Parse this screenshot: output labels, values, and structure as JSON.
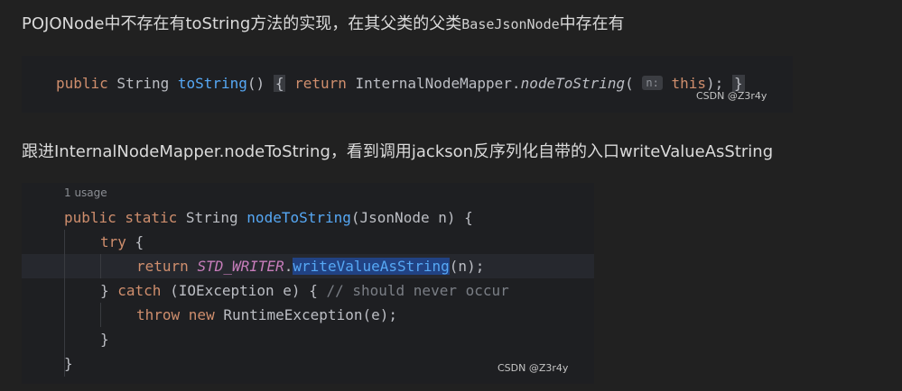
{
  "para1": {
    "before": "POJONode中不存在有toString方法的实现，在其父类的父类",
    "code": "BaseJsonNode",
    "after": "中存在有"
  },
  "snippet1": {
    "t1": "public",
    "t2": " String ",
    "t3": "toString",
    "t4": "() ",
    "t5": "{",
    "t6": " ",
    "t7": "return",
    "t8": " InternalNodeMapper.",
    "t9": "nodeToString",
    "t10": "( ",
    "hint": "n:",
    "t11": " ",
    "t12": "this",
    "t13": "); ",
    "t14": "}",
    "watermark": "CSDN @Z3r4y"
  },
  "para2": {
    "text": "跟进InternalNodeMapper.nodeToString，看到调用jackson反序列化自带的入口writeValueAsString"
  },
  "snippet2": {
    "usage": "1 usage",
    "l1": {
      "a": "public static",
      "b": " String ",
      "c": "nodeToString",
      "d": "(JsonNode n) {"
    },
    "l2": {
      "a": "try",
      "b": " {"
    },
    "l3": {
      "a": "return",
      "b": " ",
      "c": "STD_WRITER",
      "d": ".",
      "e": "writeValueAsString",
      "f": "(n);"
    },
    "l4": {
      "a": "} ",
      "b": "catch",
      "c": " (IOException e) { ",
      "d": "// should never occur"
    },
    "l5": {
      "a": "throw new",
      "b": " RuntimeException(e);"
    },
    "l6": {
      "a": "}"
    },
    "l7": {
      "a": "}"
    },
    "watermark": "CSDN @Z3r4y"
  }
}
